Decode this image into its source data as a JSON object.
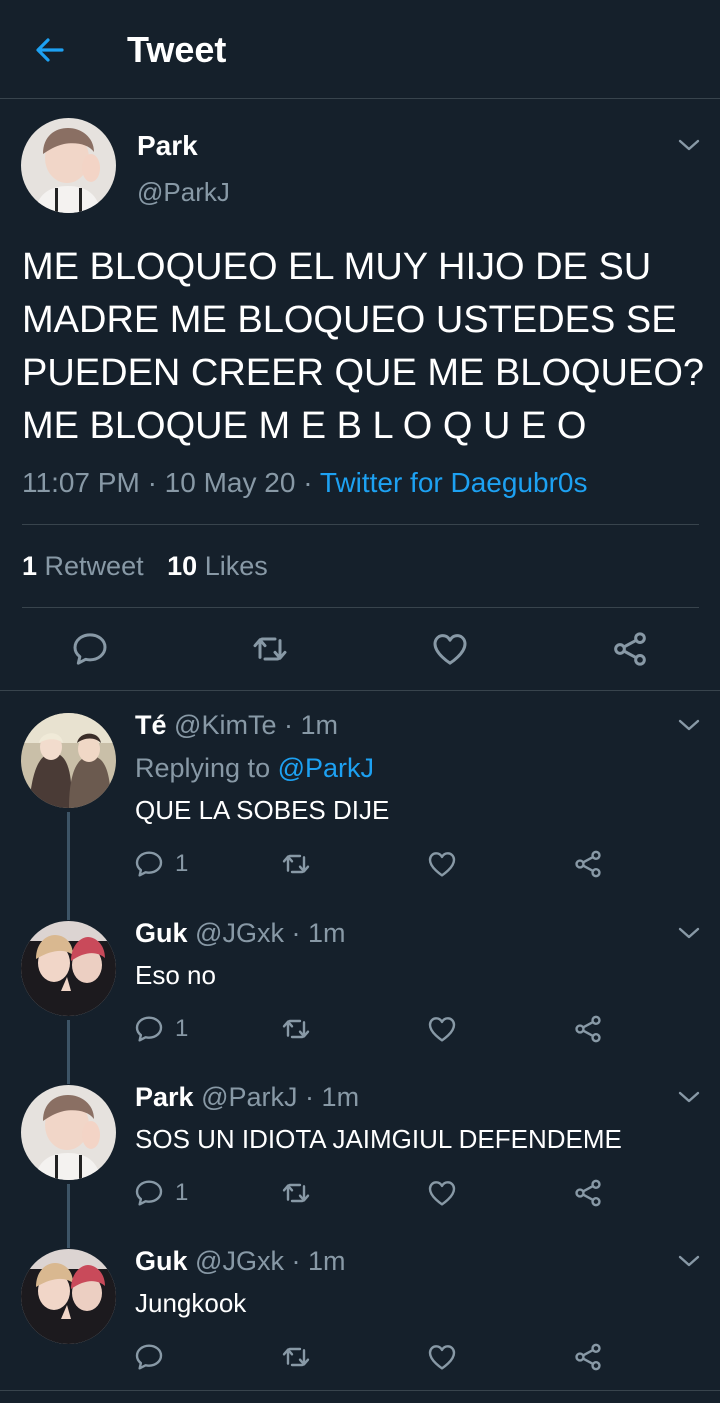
{
  "header": {
    "title": "Tweet",
    "back_icon": "arrow-left-icon",
    "accent": "#1da1f2"
  },
  "tweet": {
    "name": "Park",
    "handle": "@ParkJ",
    "text": "ME BLOQUEO EL MUY HIJO DE SU MADRE ME BLOQUEO USTEDES SE PUEDEN CREER QUE ME BLOQUEO? ME BLOQUE M E  B L O Q U E O",
    "time": "11:07 PM",
    "sep": "·",
    "date": "10 May 20",
    "source": "Twitter for Daegubr0s",
    "retweets_count": "1",
    "retweets_label": "Retweet",
    "likes_count": "10",
    "likes_label": "Likes"
  },
  "replies": [
    {
      "name": "Té",
      "handle": "@KimTe",
      "time": "1m",
      "replying_label": "Replying to",
      "replying_to": "@ParkJ",
      "text": "QUE LA SOBES DIJE",
      "reply_count": "1"
    },
    {
      "name": "Guk",
      "handle": "@JGxk",
      "time": "1m",
      "text": "Eso no",
      "reply_count": "1"
    },
    {
      "name": "Park",
      "handle": "@ParkJ",
      "time": "1m",
      "text": "SOS UN IDIOTA JAIMGIUL DEFENDEME",
      "reply_count": "1"
    },
    {
      "name": "Guk",
      "handle": "@JGxk",
      "time": "1m",
      "text": "Jungkook",
      "reply_count": ""
    }
  ],
  "colors": {
    "background": "#15202b",
    "muted": "#8899a6",
    "divider": "#38444d",
    "thread": "#3d5466"
  }
}
